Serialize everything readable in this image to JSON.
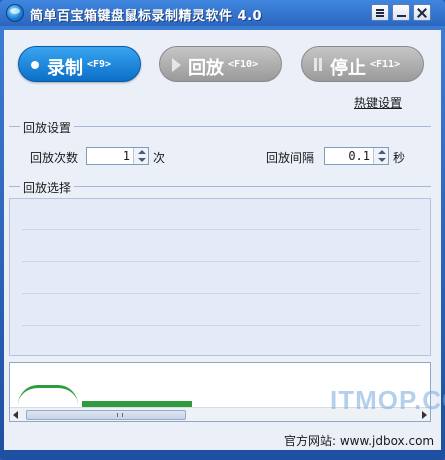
{
  "window": {
    "title": "简单百宝箱键盘鼠标录制精灵软件 4.0"
  },
  "toolbar": {
    "record": {
      "label": "录制",
      "key": "<F9>"
    },
    "play": {
      "label": "回放",
      "key": "<F10>"
    },
    "stop": {
      "label": "停止",
      "key": "<F11>"
    }
  },
  "hotkey_settings_label": "热键设置",
  "playback_settings": {
    "group_title": "回放设置",
    "count_label": "回放次数",
    "count_value": "1",
    "count_unit": "次",
    "interval_label": "回放间隔",
    "interval_value": "0.1",
    "interval_unit": "秒"
  },
  "playback_selection": {
    "group_title": "回放选择"
  },
  "statusbar": {
    "site_text": "官方网站: www.jdbox.com"
  },
  "watermark": "ITMOP.COM",
  "icons": {
    "app": "app-globe-icon",
    "menu": "menu-icon",
    "minimize": "minimize-icon",
    "close": "close-icon"
  }
}
